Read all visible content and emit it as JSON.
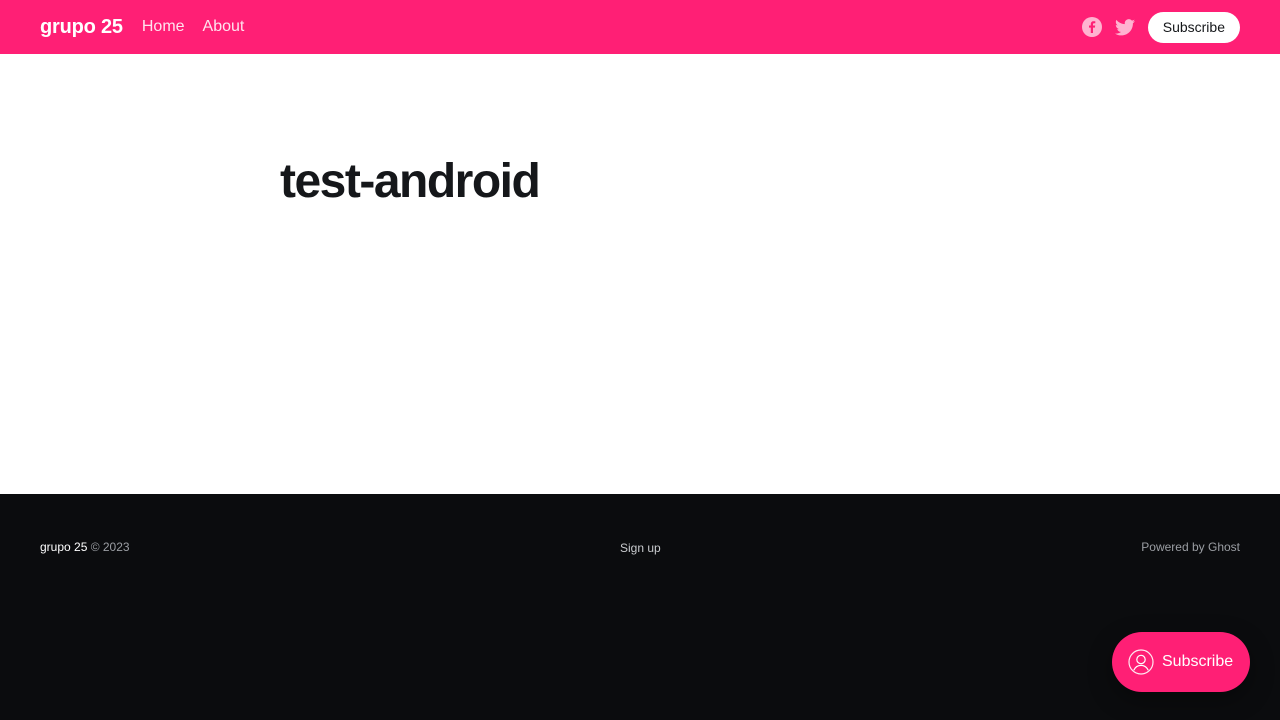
{
  "header": {
    "site_title": "grupo 25",
    "nav": [
      {
        "label": "Home"
      },
      {
        "label": "About"
      }
    ],
    "social": [
      {
        "icon": "facebook-icon"
      },
      {
        "icon": "twitter-icon"
      }
    ],
    "subscribe_label": "Subscribe"
  },
  "main": {
    "title": "test-android"
  },
  "footer": {
    "brand": "grupo 25",
    "copyright": " © 2023",
    "signup": "Sign up",
    "powered": "Powered by Ghost"
  },
  "portal": {
    "label": "Subscribe",
    "icon": "user-icon"
  },
  "colors": {
    "accent": "#ff1f75",
    "footer_bg": "#0b0c0e"
  }
}
